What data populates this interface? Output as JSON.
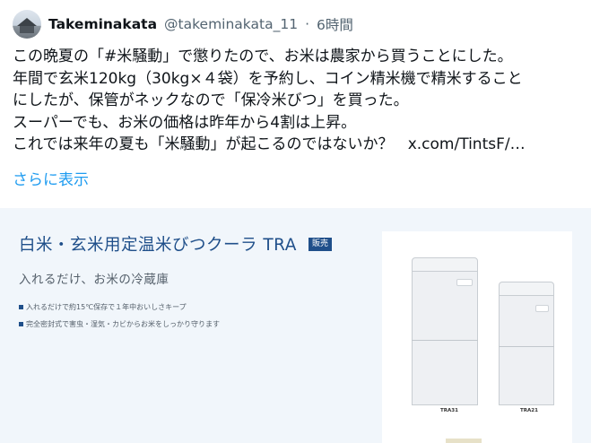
{
  "tweet": {
    "author_name": "Takeminakata",
    "handle": "@takeminakata_11",
    "separator": "·",
    "time": "6時間",
    "text_lines": [
      "この晩夏の「#米騒動」で懲りたので、お米は農家から買うことにした。",
      "年間で玄米120kg（30kg×４袋）を予約し、コイン精米機で精米すること",
      "にしたが、保管がネックなので「保冷米びつ」を買った。",
      "スーパーでも、お米の価格は昨年から4割は上昇。",
      "これでは来年の夏も「米騒動」が起こるのではないか？"
    ],
    "link_text": "x.com/TintsF/…",
    "show_more": "さらに表示"
  },
  "card": {
    "title": "白米・玄米用定温米びつクーラ TRA",
    "badge": "販売",
    "subtitle": "入れるだけ、お米の冷蔵庫",
    "features": [
      "入れるだけで約15℃保存で１年中おいしさキープ",
      "完全密封式で害虫・湿気・カビからお米をしっかり守ります"
    ],
    "products": [
      "TRA31",
      "TRA21"
    ]
  }
}
